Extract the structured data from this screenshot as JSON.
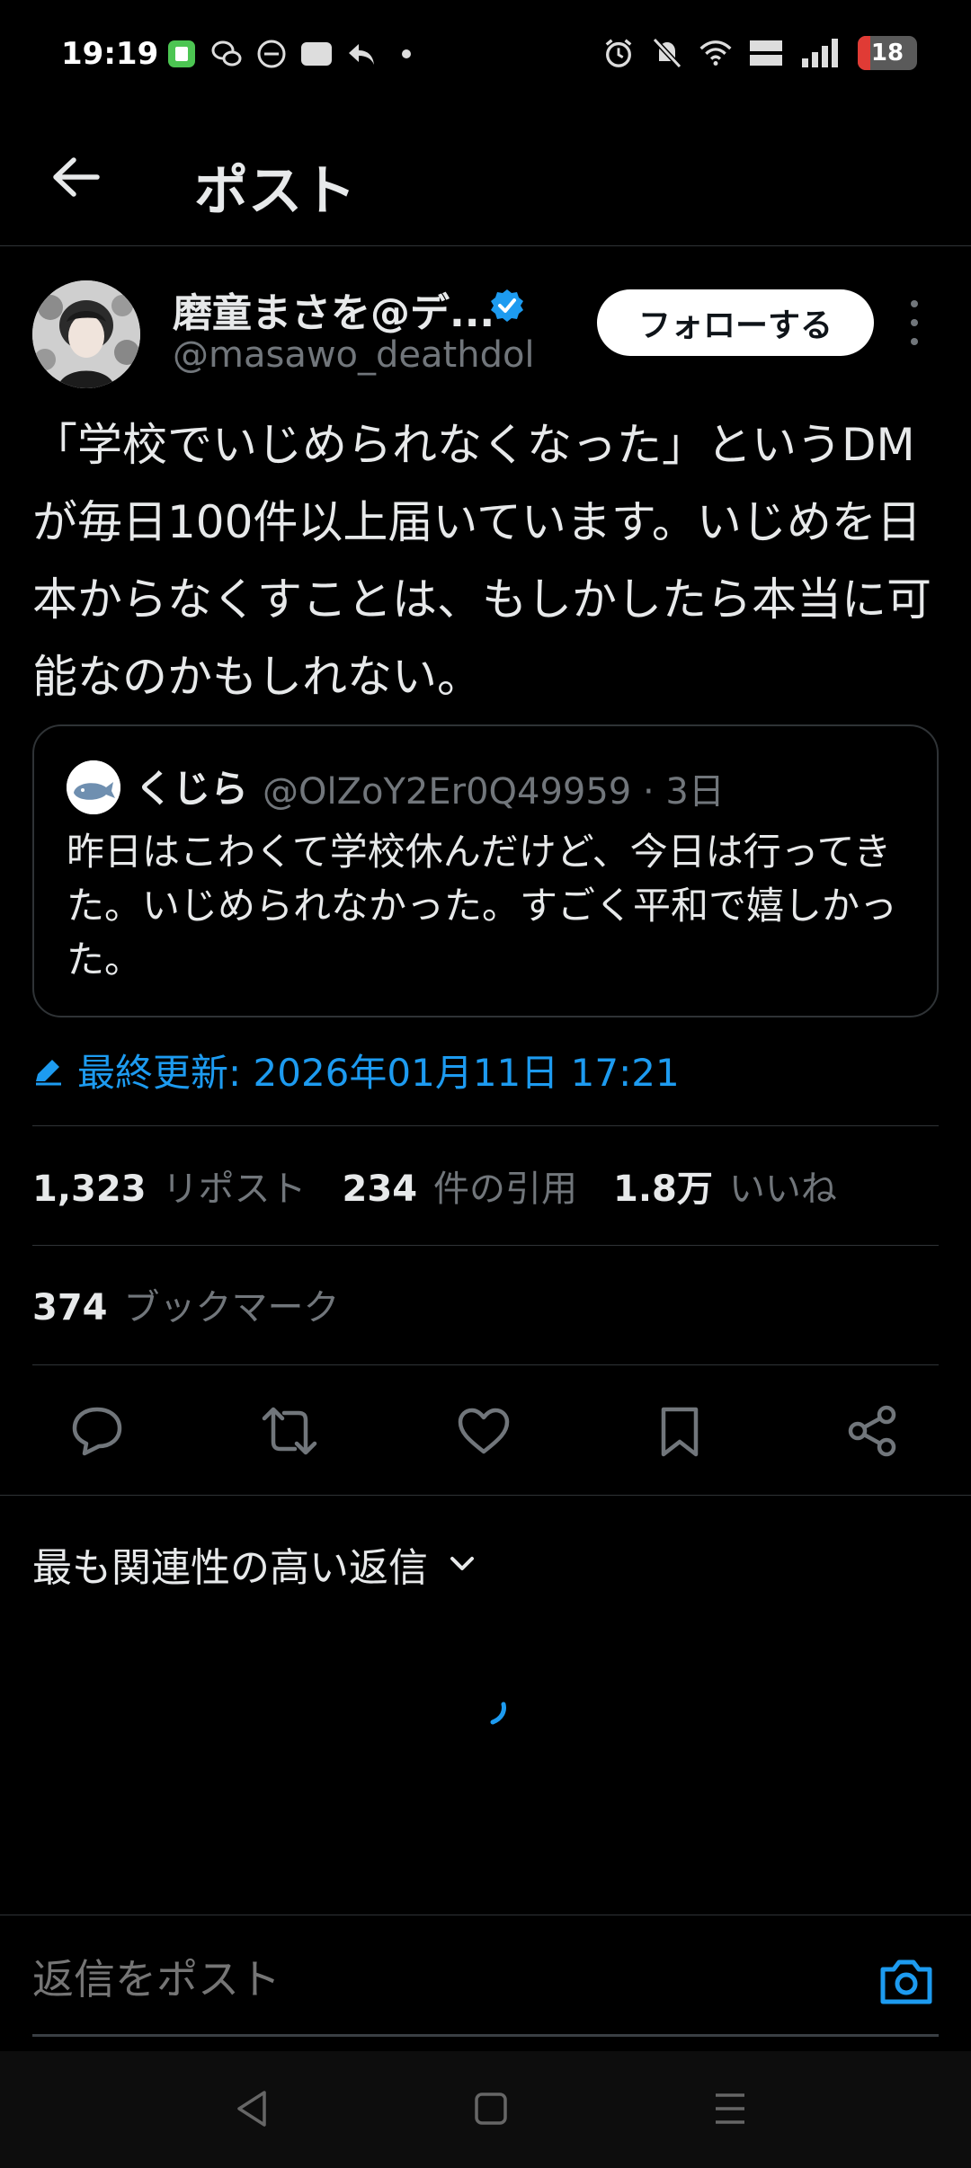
{
  "status_bar": {
    "time": "19:19",
    "battery": "18",
    "left_icons": [
      "app-icon",
      "wechat-icon",
      "chat-icon",
      "nhk-icon",
      "reply-arrow-icon",
      "dot-icon"
    ],
    "right_icons": [
      "alarm-icon",
      "bell-muted-icon",
      "wifi-icon",
      "volte-icon",
      "signal-icon",
      "battery-icon"
    ],
    "volte_label": "Vo LTE",
    "nhk_label": "NHK"
  },
  "header": {
    "title": "ポスト"
  },
  "author": {
    "name": "磨童まさを@デ...",
    "handle": "@masawo_deathdol",
    "follow_label": "フォローする",
    "verified_color": "#1d9bf0"
  },
  "post": {
    "text": "「学校でいじめられなくなった」というDMが毎日100件以上届いています。いじめを日本からなくすことは、もしかしたら本当に可能なのかもしれない。"
  },
  "quote": {
    "name": "くじら",
    "meta": "@OlZoY2Er0Q49959 · 3日",
    "text": "昨日はこわくて学校休んだけど、今日は行ってきた。いじめられなかった。すごく平和で嬉しかった。"
  },
  "updated": {
    "text": "最終更新: 2026年01月11日 17:21",
    "color": "#1d9bf0"
  },
  "stats": {
    "reposts_count": "1,323",
    "reposts_label": "リポスト",
    "quotes_count": "234",
    "quotes_label": "件の引用",
    "likes_count": "1.8万",
    "likes_label": "いいね",
    "bookmarks_count": "374",
    "bookmarks_label": "ブックマーク"
  },
  "actions": [
    "reply-icon",
    "repost-icon",
    "like-icon",
    "bookmark-icon",
    "share-icon"
  ],
  "replies": {
    "sort_label": "最も関連性の高い返信"
  },
  "reply_bar": {
    "placeholder": "返信をポスト"
  },
  "navbar": [
    "back-nav-icon",
    "home-nav-icon",
    "recents-nav-icon"
  ]
}
